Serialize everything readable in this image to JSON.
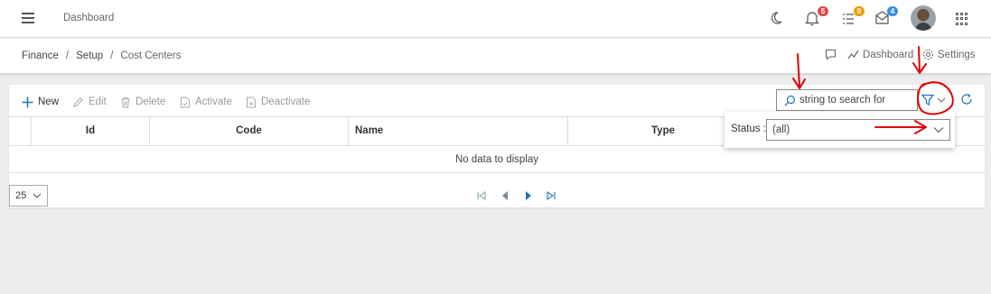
{
  "header": {
    "title": "Dashboard",
    "notifications_count": "5",
    "tasks_count": "0",
    "messages_count": "4",
    "colors": {
      "bell_badge": "#e14d4d",
      "tasks_badge": "#e6a100",
      "mail_badge": "#3a8ee6"
    },
    "icons": [
      "menu-icon",
      "moon-icon",
      "bell-icon",
      "tasks-icon",
      "mail-icon",
      "avatar",
      "apps-grid-icon"
    ]
  },
  "breadcrumb": {
    "items": [
      "Finance",
      "Setup",
      "Cost Centers"
    ],
    "separator": "/",
    "actions": {
      "dashboard_label": "Dashboard",
      "settings_label": "Settings"
    }
  },
  "toolbar": {
    "new_label": "New",
    "edit_label": "Edit",
    "delete_label": "Delete",
    "activate_label": "Activate",
    "deactivate_label": "Deactivate",
    "search_placeholder": "string to search for"
  },
  "table": {
    "columns": [
      "Id",
      "Code",
      "Name",
      "Type"
    ],
    "empty_text": "No data to display"
  },
  "pager": {
    "page_size": "25"
  },
  "filter_popup": {
    "status_label": "Status :",
    "status_value": "(all)"
  },
  "accent_color": "#1e73be",
  "annotation_color": "#e00000"
}
